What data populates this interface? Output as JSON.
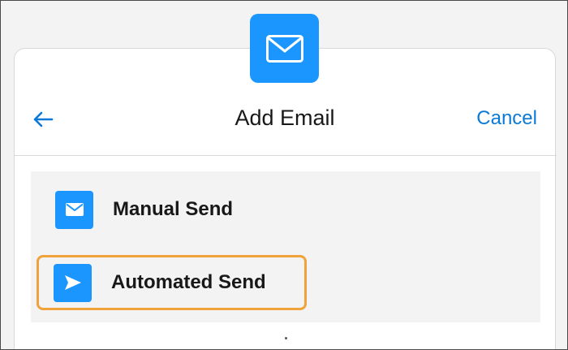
{
  "header": {
    "title": "Add Email",
    "cancel_label": "Cancel",
    "back_icon": "arrow-left-icon",
    "app_icon": "envelope-icon"
  },
  "options": [
    {
      "label": "Manual Send",
      "icon": "envelope-icon"
    },
    {
      "label": "Automated Send",
      "icon": "send-icon",
      "highlighted": true
    }
  ],
  "colors": {
    "accent": "#1b96ff",
    "link": "#0b7ad6",
    "highlight": "#f0a23b"
  }
}
